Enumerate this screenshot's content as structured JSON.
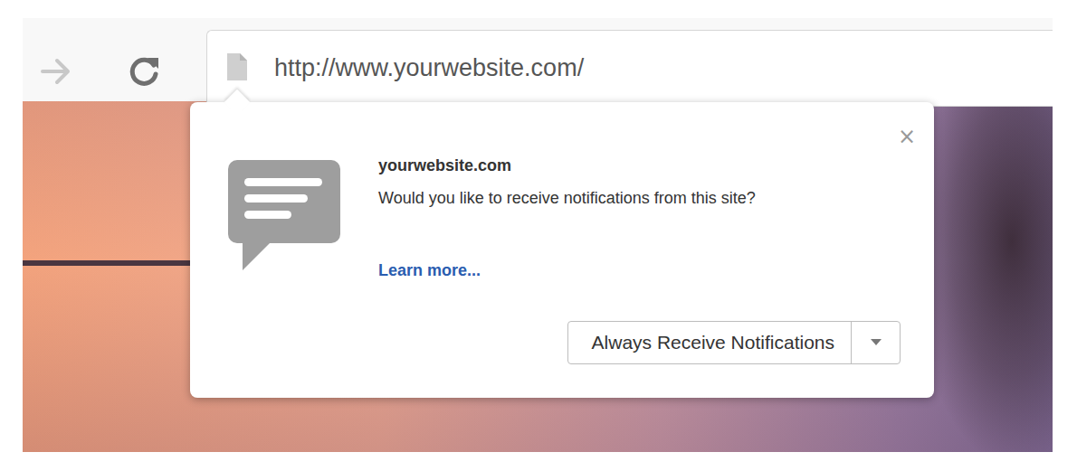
{
  "address_bar": {
    "url": "http://www.yourwebsite.com/"
  },
  "nav": {
    "forward_enabled": false,
    "reload_enabled": true
  },
  "prompt": {
    "site": "yourwebsite.com",
    "question": "Would you like to receive notifications from this site?",
    "link": "Learn more...",
    "close": "×",
    "button": "Always Receive Notifications"
  }
}
